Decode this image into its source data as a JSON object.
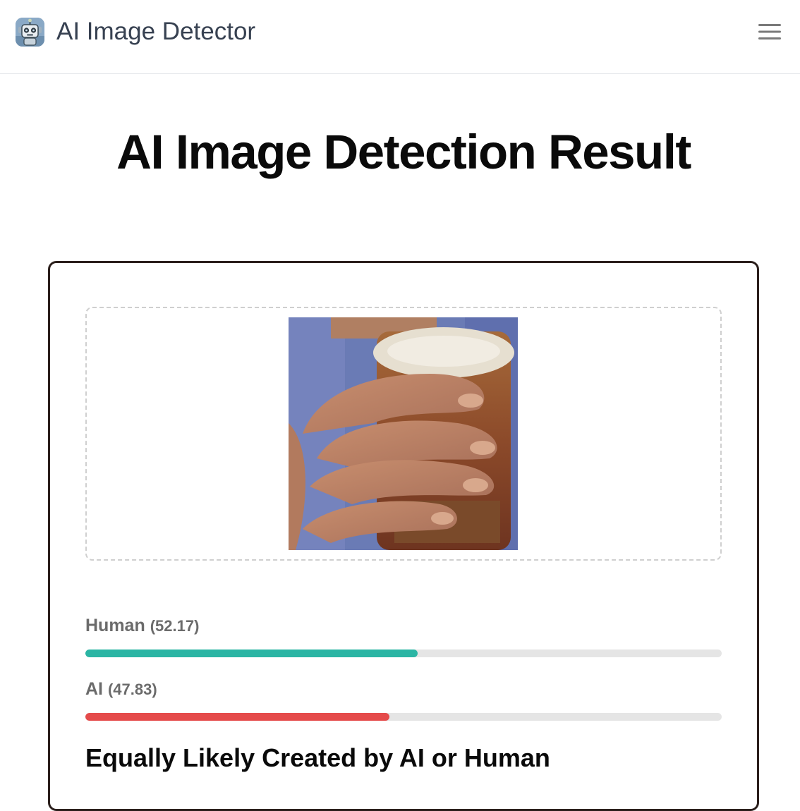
{
  "navbar": {
    "brand": "AI Image Detector",
    "logo_icon": "robot-icon",
    "menu_icon": "hamburger-menu-icon"
  },
  "main": {
    "title": "AI Image Detection Result"
  },
  "result": {
    "image_alt": "Uploaded image of a hand holding a glass of beer",
    "scores": [
      {
        "label": "Human",
        "value": "(52.17)",
        "fraction": 0.5217,
        "color": "#2bb5a4"
      },
      {
        "label": "AI",
        "value": "(47.83)",
        "fraction": 0.4783,
        "color": "#e54b4b"
      }
    ],
    "verdict": "Equally Likely Created by AI or Human"
  }
}
